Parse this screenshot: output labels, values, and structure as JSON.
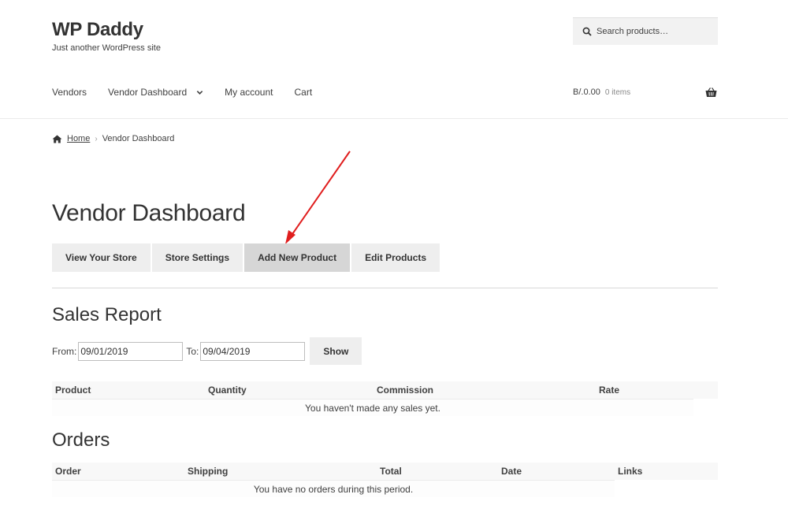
{
  "site": {
    "title": "WP Daddy",
    "tagline": "Just another WordPress site"
  },
  "search": {
    "placeholder": "Search products…"
  },
  "nav": {
    "items": [
      "Vendors",
      "Vendor Dashboard",
      "My account",
      "Cart"
    ]
  },
  "cart": {
    "total": "B/.0.00",
    "count": "0 items"
  },
  "breadcrumb": {
    "home": "Home",
    "current": "Vendor Dashboard"
  },
  "page": {
    "title": "Vendor Dashboard"
  },
  "dashboard_buttons": [
    "View Your Store",
    "Store Settings",
    "Add New Product",
    "Edit Products"
  ],
  "sales_report": {
    "title": "Sales Report",
    "from_label": "From:",
    "from_value": "09/01/2019",
    "to_label": "To:",
    "to_value": "09/04/2019",
    "show_label": "Show",
    "columns": [
      "Product",
      "Quantity",
      "Commission",
      "Rate"
    ],
    "empty_message": "You haven't made any sales yet."
  },
  "orders": {
    "title": "Orders",
    "columns": [
      "Order",
      "Shipping",
      "Total",
      "Date",
      "Links"
    ],
    "empty_message": "You have no orders during this period."
  },
  "colors": {
    "annotation_arrow": "#e01e1e",
    "button_bg": "#eeeeee",
    "button_active_bg": "#d6d6d6"
  }
}
